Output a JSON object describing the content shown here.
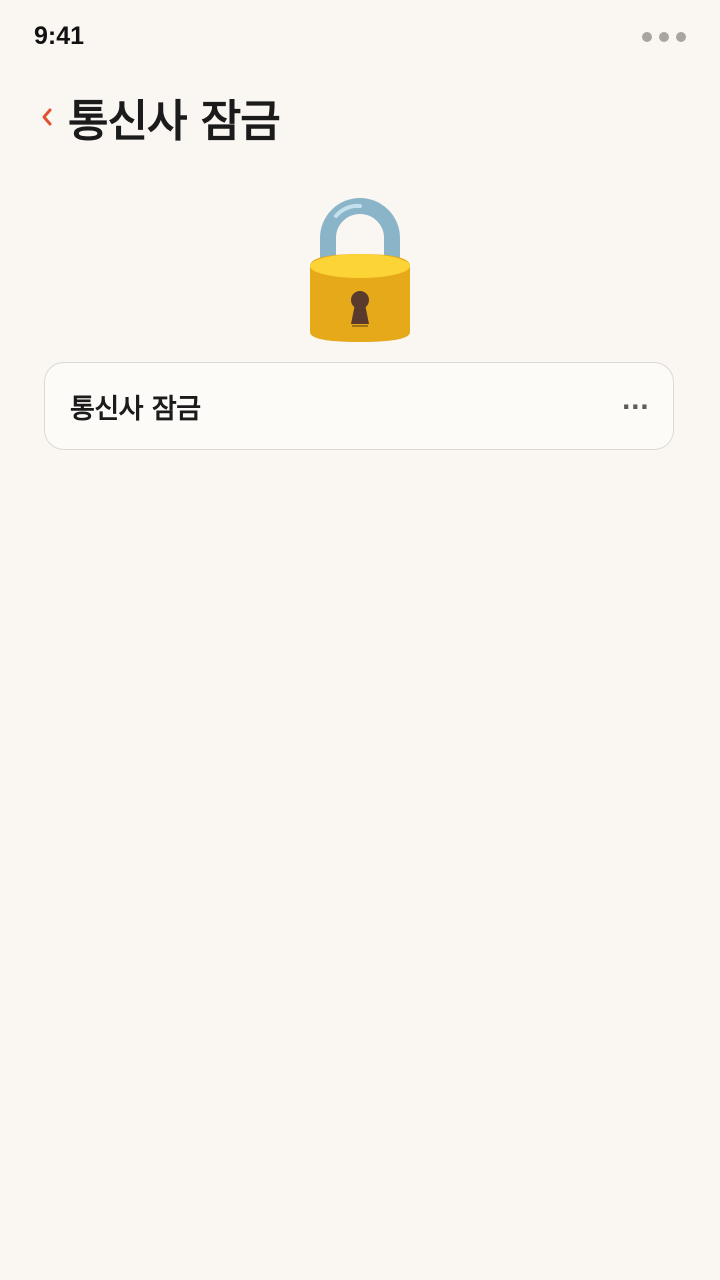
{
  "status_bar": {
    "time": "9:41",
    "menu_icon": "more-dots-icon"
  },
  "header": {
    "back_icon": "chevron-left-icon",
    "title": "통신사 잠금"
  },
  "illustration": {
    "icon": "padlock-icon"
  },
  "card": {
    "title": "통신사 잠금",
    "more_label": "...",
    "more_icon": "ellipsis-icon"
  },
  "colors": {
    "background": "#faf7f3",
    "accent": "#e2502f",
    "card_border": "#dcd9d5",
    "lock_body": "#e6a91a",
    "lock_shackle": "#8ab5c9"
  }
}
